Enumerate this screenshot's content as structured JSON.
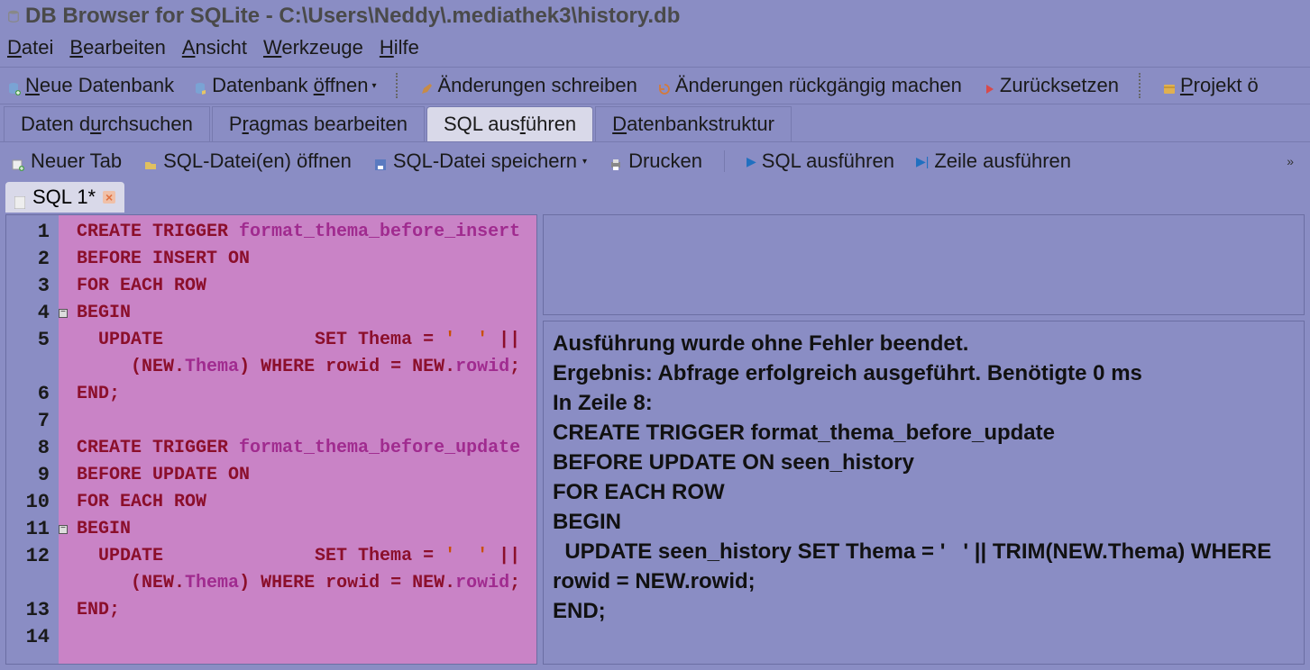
{
  "window": {
    "title": "DB Browser for SQLite - C:\\Users\\Neddy\\.mediathek3\\history.db"
  },
  "menubar": {
    "items": [
      "Datei",
      "Bearbeiten",
      "Ansicht",
      "Werkzeuge",
      "Hilfe"
    ]
  },
  "toolbar": {
    "new_db": "Neue Datenbank",
    "open_db": "Datenbank öffnen",
    "write_changes": "Änderungen schreiben",
    "revert_changes": "Änderungen rückgängig machen",
    "reset": "Zurücksetzen",
    "open_project": "Projekt ö"
  },
  "main_tabs": {
    "items": [
      "Daten durchsuchen",
      "Pragmas bearbeiten",
      "SQL ausführen",
      "Datenbankstruktur"
    ],
    "active_index": 2
  },
  "sql_toolbar": {
    "new_tab": "Neuer Tab",
    "open_sql": "SQL-Datei(en) öffnen",
    "save_sql": "SQL-Datei speichern",
    "print": "Drucken",
    "run_sql": "SQL ausführen",
    "run_line": "Zeile ausführen"
  },
  "sql_tabs": {
    "items": [
      {
        "label": "SQL 1*"
      }
    ],
    "active_index": 0
  },
  "editor": {
    "line_numbers": [
      "1",
      "2",
      "3",
      "4",
      "5",
      "",
      "6",
      "7",
      "8",
      "9",
      "10",
      "11",
      "12",
      "",
      "13",
      "14"
    ],
    "lines": [
      [
        {
          "t": "CREATE TRIGGER ",
          "c": "kw"
        },
        {
          "t": "format_thema_before_insert",
          "c": "ident"
        }
      ],
      [
        {
          "t": "BEFORE INSERT ON",
          "c": "kw"
        }
      ],
      [
        {
          "t": "FOR EACH ROW",
          "c": "kw"
        }
      ],
      [
        {
          "t": "BEGIN",
          "c": "kw"
        }
      ],
      [
        {
          "t": "  UPDATE              ",
          "c": "kw"
        },
        {
          "t": "SET Thema",
          "c": "kw"
        },
        {
          "t": " = ",
          "c": "op"
        },
        {
          "t": "'  '",
          "c": "str"
        },
        {
          "t": " || ",
          "c": "op"
        }
      ],
      [
        {
          "t": "     (",
          "c": "op"
        },
        {
          "t": "NEW",
          "c": "kw"
        },
        {
          "t": ".",
          "c": "op"
        },
        {
          "t": "Thema",
          "c": "ident"
        },
        {
          "t": ") ",
          "c": "op"
        },
        {
          "t": "WHERE rowid",
          "c": "kw"
        },
        {
          "t": " = ",
          "c": "op"
        },
        {
          "t": "NEW",
          "c": "kw"
        },
        {
          "t": ".",
          "c": "op"
        },
        {
          "t": "rowid",
          "c": "ident"
        },
        {
          "t": ";",
          "c": "op"
        }
      ],
      [
        {
          "t": "END",
          "c": "kw"
        },
        {
          "t": ";",
          "c": "op"
        }
      ],
      [],
      [
        {
          "t": "CREATE TRIGGER ",
          "c": "kw"
        },
        {
          "t": "format_thema_before_update",
          "c": "ident"
        }
      ],
      [
        {
          "t": "BEFORE UPDATE ON",
          "c": "kw"
        }
      ],
      [
        {
          "t": "FOR EACH ROW",
          "c": "kw"
        }
      ],
      [
        {
          "t": "BEGIN",
          "c": "kw"
        }
      ],
      [
        {
          "t": "  UPDATE              ",
          "c": "kw"
        },
        {
          "t": "SET Thema",
          "c": "kw"
        },
        {
          "t": " = ",
          "c": "op"
        },
        {
          "t": "'  '",
          "c": "str"
        },
        {
          "t": " || ",
          "c": "op"
        }
      ],
      [
        {
          "t": "     (",
          "c": "op"
        },
        {
          "t": "NEW",
          "c": "kw"
        },
        {
          "t": ".",
          "c": "op"
        },
        {
          "t": "Thema",
          "c": "ident"
        },
        {
          "t": ") ",
          "c": "op"
        },
        {
          "t": "WHERE rowid",
          "c": "kw"
        },
        {
          "t": " = ",
          "c": "op"
        },
        {
          "t": "NEW",
          "c": "kw"
        },
        {
          "t": ".",
          "c": "op"
        },
        {
          "t": "rowid",
          "c": "ident"
        },
        {
          "t": ";",
          "c": "op"
        }
      ],
      [
        {
          "t": "END",
          "c": "kw"
        },
        {
          "t": ";",
          "c": "op"
        }
      ],
      []
    ],
    "fold_rows": [
      3,
      11
    ]
  },
  "results": {
    "text": "Ausführung wurde ohne Fehler beendet.\nErgebnis: Abfrage erfolgreich ausgeführt. Benötigte 0 ms\nIn Zeile 8:\nCREATE TRIGGER format_thema_before_update\nBEFORE UPDATE ON seen_history\nFOR EACH ROW\nBEGIN\n  UPDATE seen_history SET Thema = '   ' || TRIM(NEW.Thema) WHERE rowid = NEW.rowid;\nEND;"
  }
}
